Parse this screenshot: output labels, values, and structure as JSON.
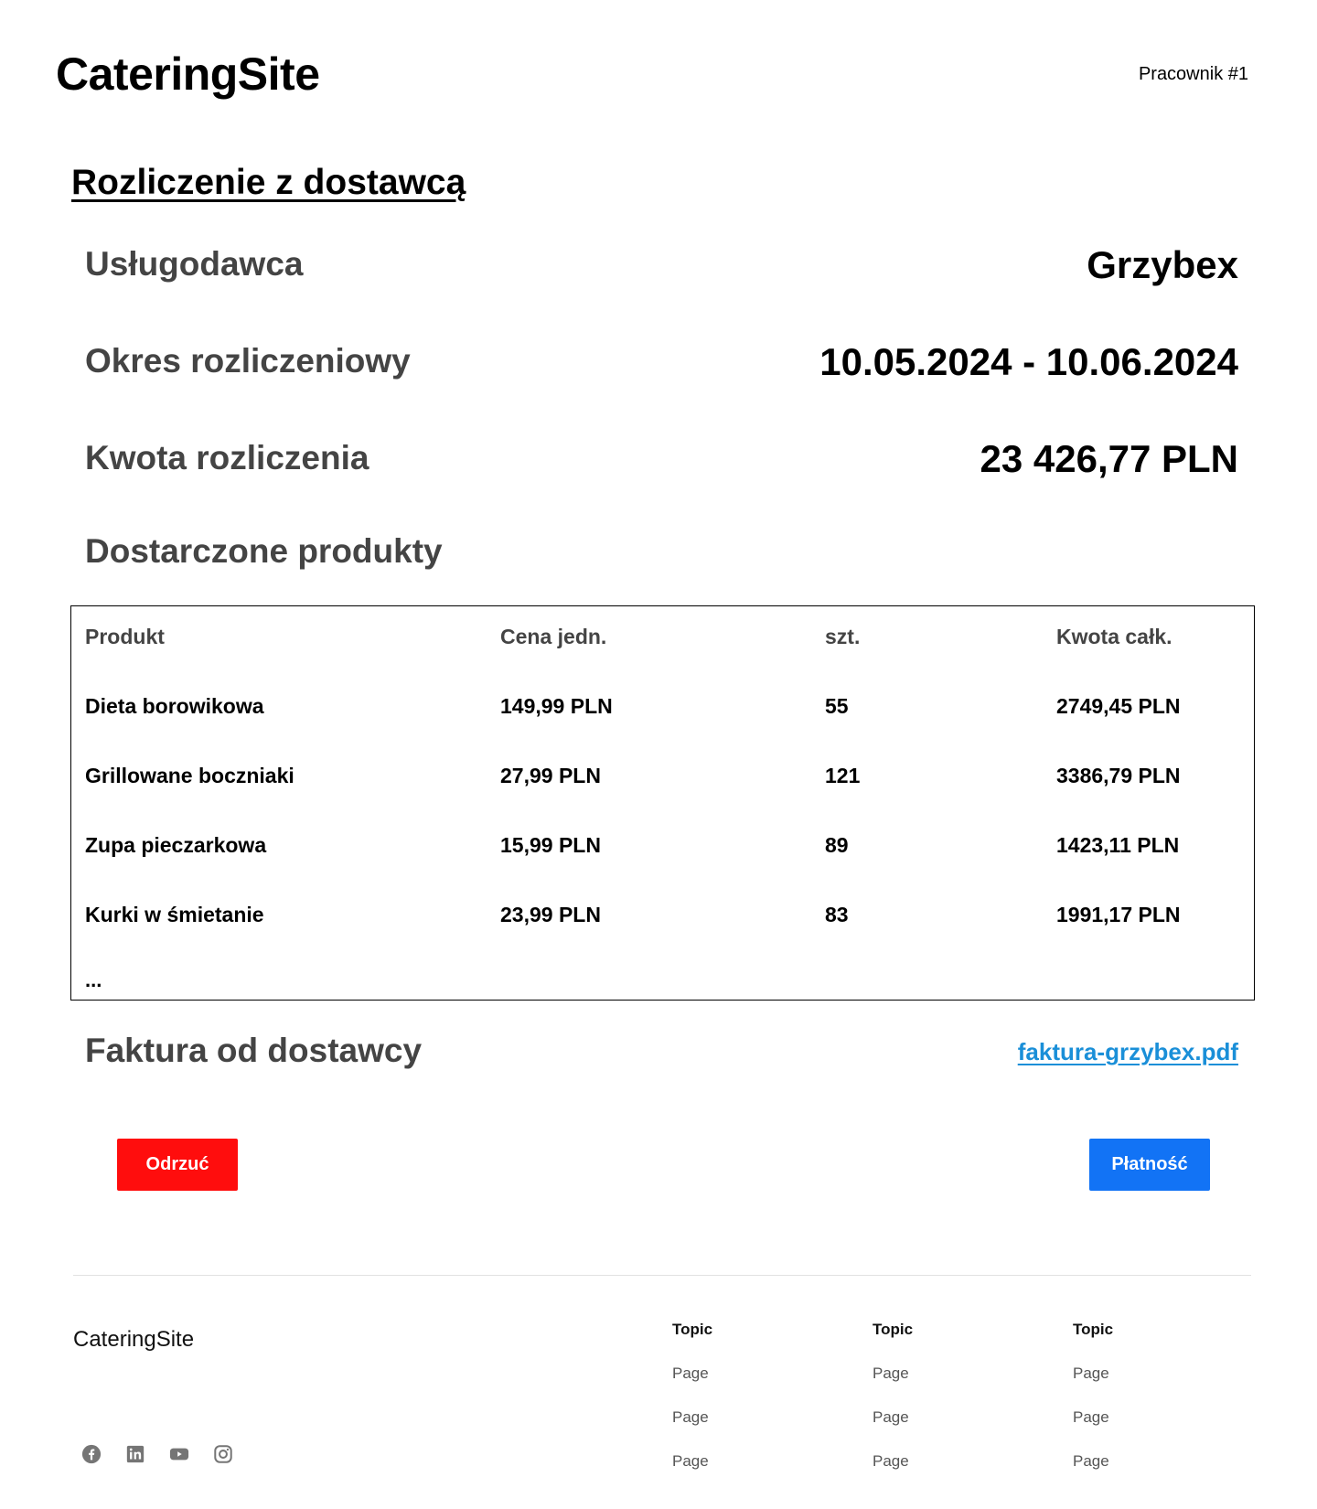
{
  "header": {
    "logo": "CateringSite",
    "user": "Pracownik #1"
  },
  "page": {
    "title": "Rozliczenie z dostawcą"
  },
  "summary": {
    "provider_label": "Usługodawca",
    "provider_value": "Grzybex",
    "period_label": "Okres rozliczeniowy",
    "period_value": "10.05.2024 - 10.06.2024",
    "amount_label": "Kwota rozliczenia",
    "amount_value": "23 426,77 PLN"
  },
  "products": {
    "section_title": "Dostarczone produkty",
    "headers": [
      "Produkt",
      "Cena jedn.",
      "szt.",
      "Kwota całk."
    ],
    "rows": [
      [
        "Dieta borowikowa",
        "149,99 PLN",
        "55",
        "2749,45 PLN"
      ],
      [
        "Grillowane boczniaki",
        "27,99 PLN",
        "121",
        "3386,79 PLN"
      ],
      [
        "Zupa pieczarkowa",
        "15,99 PLN",
        "89",
        "1423,11 PLN"
      ],
      [
        "Kurki w śmietanie",
        "23,99 PLN",
        "83",
        "1991,17 PLN"
      ]
    ],
    "more": "..."
  },
  "invoice": {
    "label": "Faktura od dostawcy",
    "file": "faktura-grzybex.pdf"
  },
  "actions": {
    "reject_label": "Odrzuć",
    "pay_label": "Płatność",
    "reject_color": "#ff0d0d",
    "pay_color": "#1273f5"
  },
  "footer": {
    "brand": "CateringSite",
    "social_icons": [
      "facebook-icon",
      "linkedin-icon",
      "youtube-icon",
      "instagram-icon"
    ],
    "columns": [
      {
        "title": "Topic",
        "links": [
          "Page",
          "Page",
          "Page"
        ]
      },
      {
        "title": "Topic",
        "links": [
          "Page",
          "Page",
          "Page"
        ]
      },
      {
        "title": "Topic",
        "links": [
          "Page",
          "Page",
          "Page"
        ]
      }
    ]
  }
}
